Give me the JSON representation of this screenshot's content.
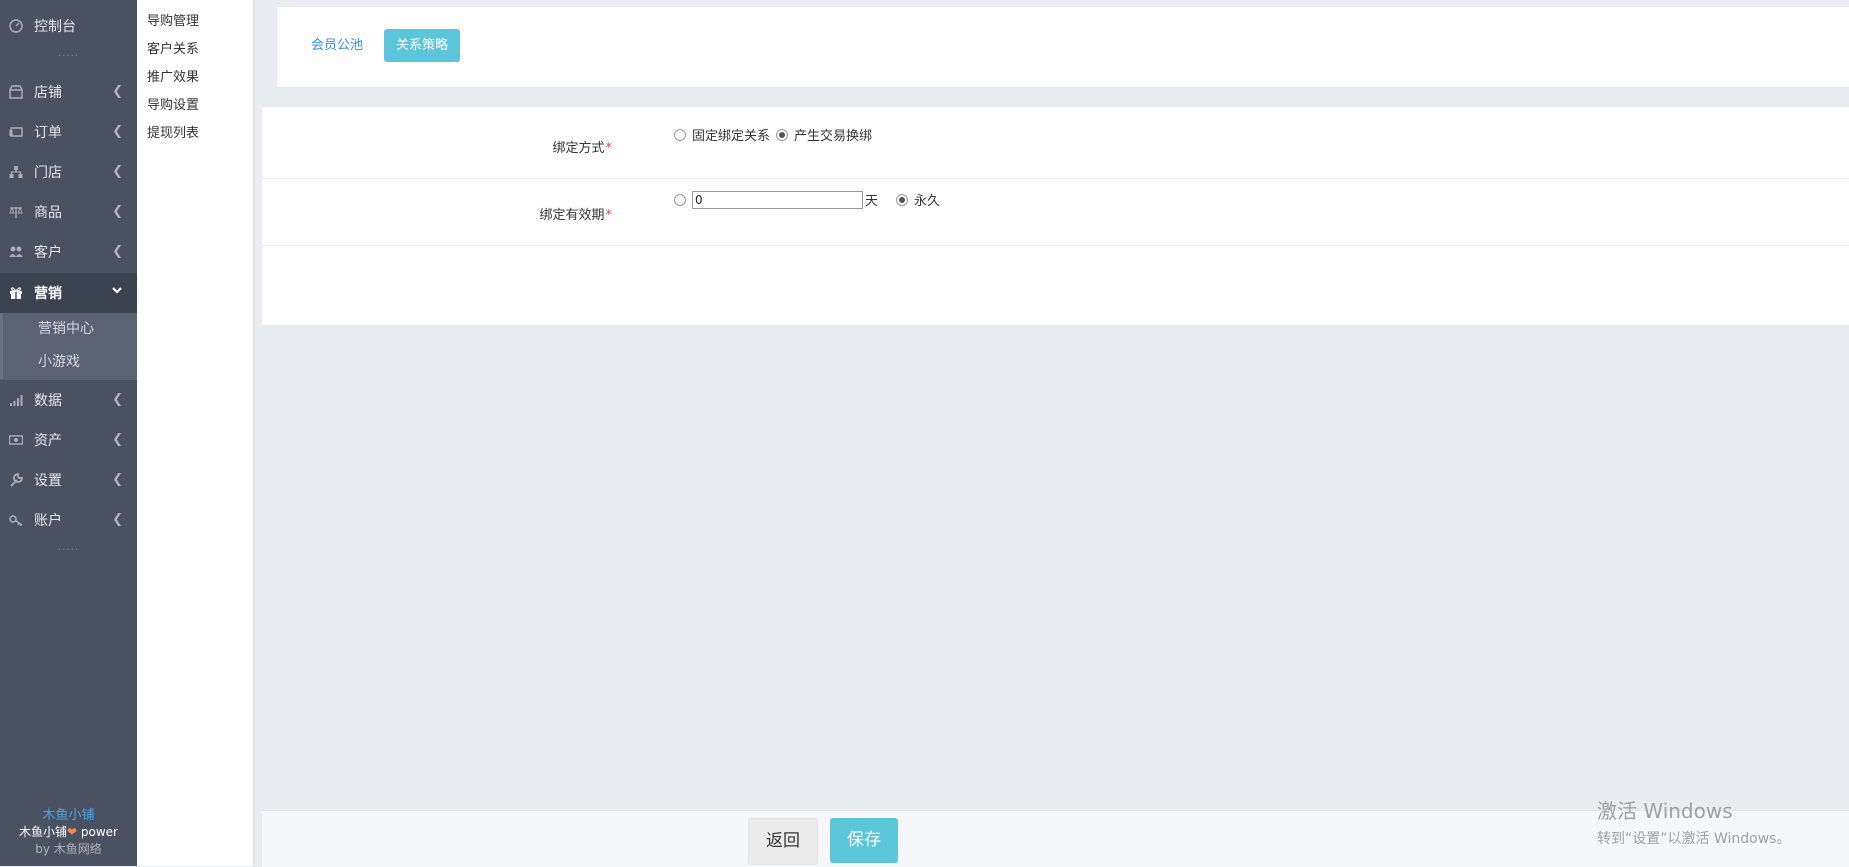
{
  "sidebar": {
    "top_item": {
      "label": "控制台",
      "icon": "dashboard-icon"
    },
    "items": [
      {
        "label": "店铺",
        "icon": "shop-icon"
      },
      {
        "label": "订单",
        "icon": "order-icon"
      },
      {
        "label": "门店",
        "icon": "store-tree-icon"
      },
      {
        "label": "商品",
        "icon": "scale-icon"
      },
      {
        "label": "客户",
        "icon": "users-icon"
      },
      {
        "label": "营销",
        "icon": "gift-icon",
        "active": true
      },
      {
        "label": "数据",
        "icon": "bar-chart-icon"
      },
      {
        "label": "资产",
        "icon": "money-icon"
      },
      {
        "label": "设置",
        "icon": "wrench-icon"
      },
      {
        "label": "账户",
        "icon": "key-icon"
      }
    ],
    "sub_items": [
      "营销中心",
      "小游戏"
    ],
    "dots": "·····",
    "footer": {
      "brand": "木鱼小铺",
      "line2_prefix": "木鱼小铺",
      "line2_suffix": " power",
      "line3": "by 木鱼网络"
    }
  },
  "submenu": {
    "items": [
      "导购管理",
      "客户关系",
      "推广效果",
      "导购设置",
      "提现列表"
    ]
  },
  "tabs": [
    {
      "label": "会员公池",
      "active": false
    },
    {
      "label": "关系策略",
      "active": true
    }
  ],
  "form": {
    "bind_method": {
      "label": "绑定方式",
      "required_mark": "*",
      "options": [
        {
          "label": "固定绑定关系",
          "checked": false
        },
        {
          "label": "产生交易换绑",
          "checked": true
        }
      ]
    },
    "bind_validity": {
      "label": "绑定有效期",
      "required_mark": "*",
      "days_value": "0",
      "days_unit": "天",
      "days_checked": false,
      "forever_label": "永久",
      "forever_checked": true
    }
  },
  "actions": {
    "back_label": "返回",
    "save_label": "保存"
  },
  "watermark": {
    "line1": "激活 Windows",
    "line2": "转到“设置”以激活 Windows。"
  },
  "colors": {
    "sidebar_bg": "#4a5261",
    "accent": "#5bc5d9",
    "link": "#3c8ddb",
    "required": "#e04a4a"
  }
}
